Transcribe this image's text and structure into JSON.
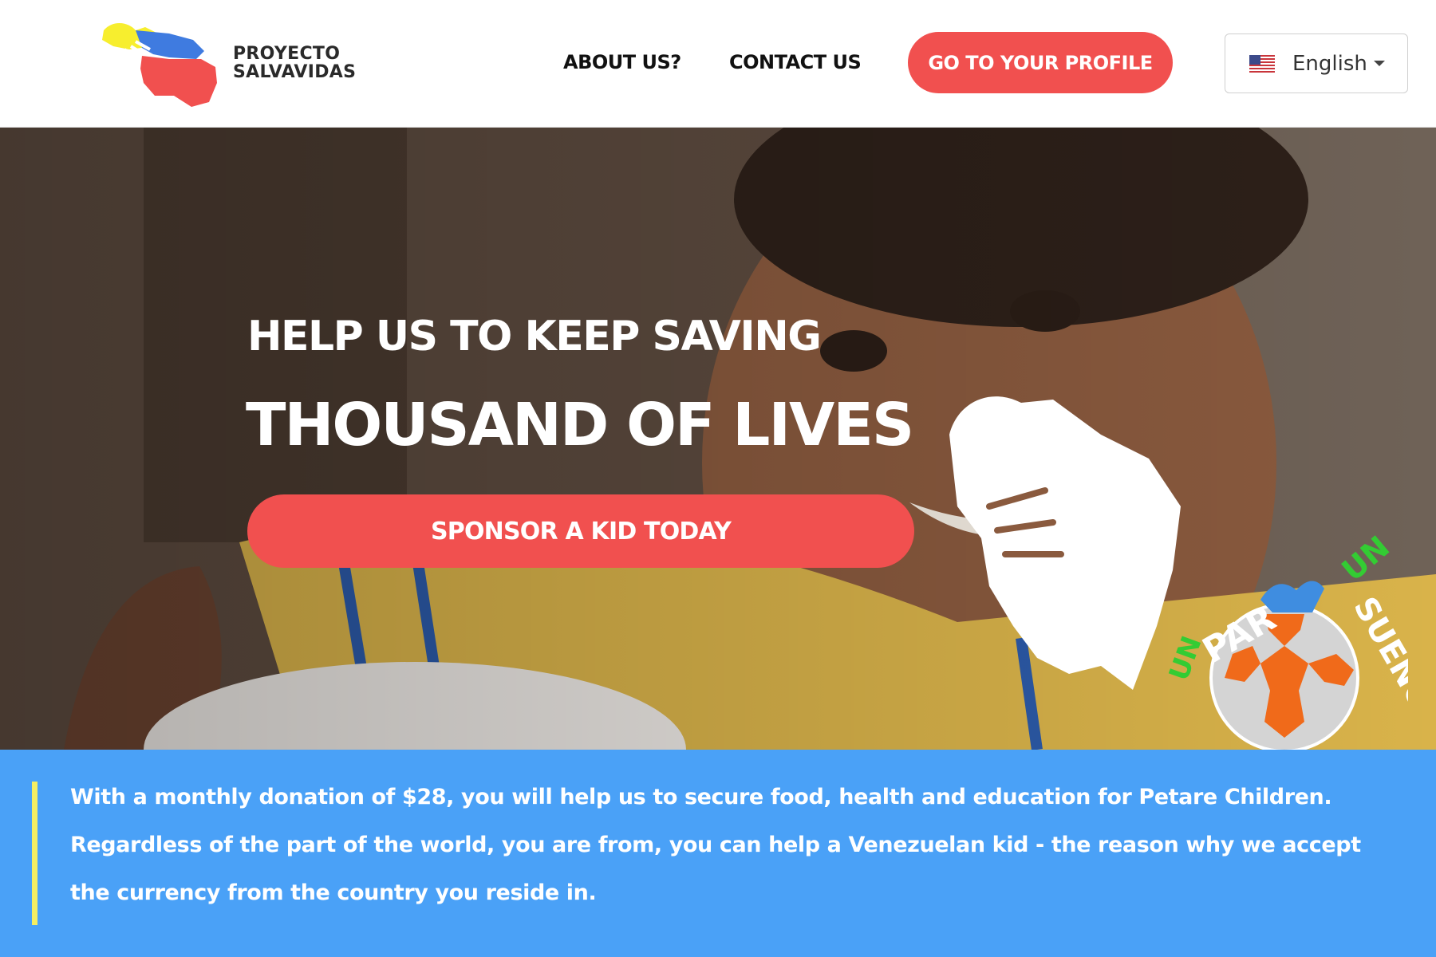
{
  "brand": {
    "line1": "PROYECTO",
    "line2": "SALVAVIDAS",
    "logo_icon": "venezuela-map-logo",
    "logo_colors": [
      "#f7ee2e",
      "#3f7be0",
      "#f1504f"
    ]
  },
  "nav": {
    "about_label": "ABOUT US?",
    "contact_label": "CONTACT US",
    "profile_label": "GO TO YOUR PROFILE"
  },
  "language": {
    "selected": "English",
    "flag_icon": "us-flag-icon",
    "caret_icon": "caret-down-icon"
  },
  "hero": {
    "subtitle": "HELP US TO KEEP SAVING",
    "title": "THOUSAND OF LIVES",
    "cta_label": "SPONSOR A KID TODAY",
    "map_icon": "venezuela-map-white-icon",
    "partner_logo": {
      "word1": "UN",
      "word2": "PAR",
      "word3": "UN",
      "word4": "SUEÑO",
      "icon": "soccer-ball-logo"
    }
  },
  "info": {
    "text": "With a monthly donation of $28, you will help us to secure food, health and education for Petare Children. Regardless of the part of the world, you are from, you can help a Venezuelan kid - the reason why we accept the currency from the country you reside in."
  },
  "colors": {
    "accent": "#f1504f",
    "info_band": "#4aa1f7",
    "info_bar": "#f5ee62",
    "partner_green": "#33cc33",
    "ball_orange": "#f06a1a"
  }
}
